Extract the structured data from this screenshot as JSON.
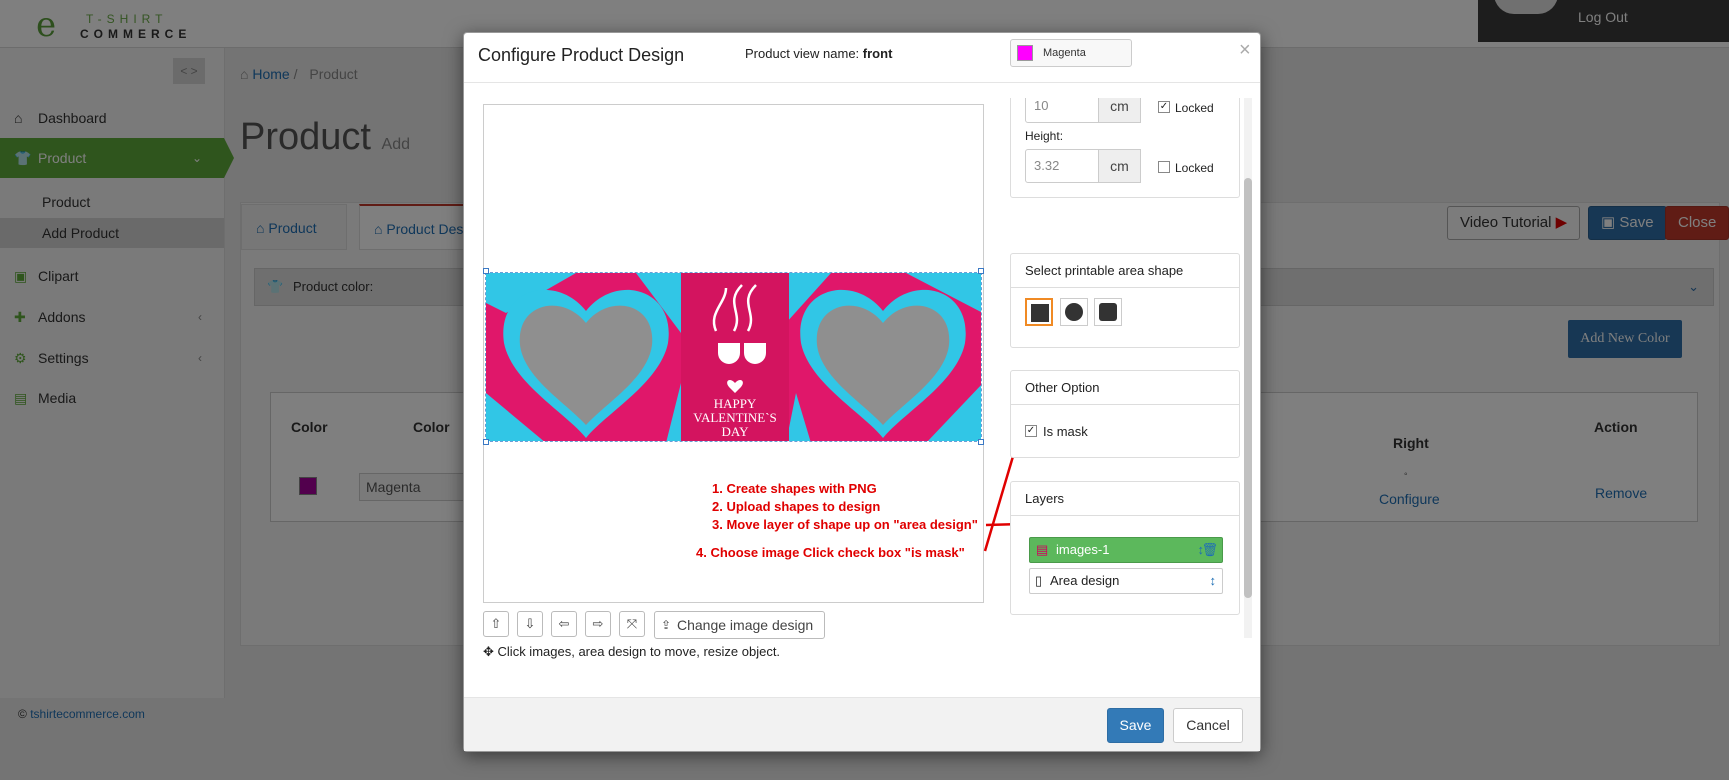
{
  "app": {
    "logo_line1": "T-SHIRT",
    "logo_line2": "COMMERCE",
    "logout": "Log Out"
  },
  "sidebar": {
    "items": [
      {
        "label": "Dashboard",
        "icon": "home-icon"
      },
      {
        "label": "Product",
        "icon": "shirt-icon"
      },
      {
        "label": "Clipart",
        "icon": "image-icon"
      },
      {
        "label": "Addons",
        "icon": "puzzle-icon"
      },
      {
        "label": "Settings",
        "icon": "gear-icon"
      },
      {
        "label": "Media",
        "icon": "media-icon"
      }
    ],
    "sub_items": [
      "Product",
      "Add Product"
    ],
    "footer": "tshirtecommerce.com",
    "footer_prefix": "©",
    "accent_color": "#5fab3a"
  },
  "breadcrumb": {
    "home": "Home",
    "current": "Product"
  },
  "page": {
    "title": "Product",
    "subtitle": "Add",
    "tabs": [
      "Product Info",
      "Product Des"
    ],
    "video_tutorial": "Video Tutorial",
    "save": "Save",
    "close": "Close",
    "product_color_label": "Product color:",
    "add_new_color": "Add New Color",
    "table": {
      "headers": [
        "Color",
        "Color",
        "Right",
        "Action"
      ],
      "row": {
        "color_name": "Magenta",
        "right_marker": "◦",
        "configure": "Configure",
        "remove": "Remove"
      }
    }
  },
  "modal": {
    "title": "Configure Product Design",
    "view_label": "Product view name:",
    "view_name": "front",
    "color_name": "Magenta",
    "color_hex": "#ff00ff",
    "close_symbol": "×",
    "width_value": "10",
    "height_label": "Height:",
    "height_value": "3.32",
    "unit": "cm",
    "locked_label": "Locked",
    "width_locked": true,
    "height_locked": false,
    "shape_title": "Select printable area shape",
    "shapes": [
      "square",
      "circle",
      "rounded-square"
    ],
    "selected_shape": "square",
    "other_title": "Other Option",
    "is_mask_label": "Is mask",
    "is_mask_checked": true,
    "layers_title": "Layers",
    "layers": [
      {
        "name": "images-1",
        "active": true
      },
      {
        "name": "Area design",
        "active": false
      }
    ],
    "design_text": {
      "line1": "HAPPY",
      "line2": "VALENTINE`S",
      "line3": "DAY"
    },
    "annotations": [
      "1. Create shapes with PNG",
      "2. Upload shapes to design",
      "3. Move layer of shape up on \"area design\"",
      "4. Choose image Click check box \"is mask\""
    ],
    "tools": [
      "arrow-up-icon",
      "arrow-down-icon",
      "arrow-left-icon",
      "arrow-right-icon",
      "compress-icon"
    ],
    "change_image": "Change image design",
    "hint": "Click images, area design to move, resize object.",
    "save": "Save",
    "cancel": "Cancel"
  }
}
